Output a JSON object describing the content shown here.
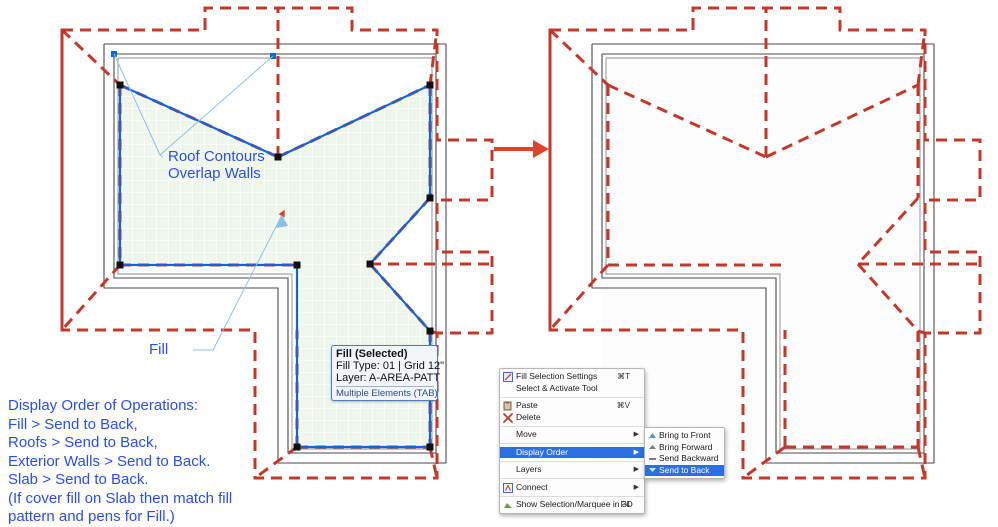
{
  "annotations": {
    "roof_contours": "Roof Contours\nOverlap Walls",
    "fill": "Fill",
    "notes": "Display Order of Operations:\nFill > Send to Back,\nRoofs > Send to Back,\nExterior Walls > Send to Back.\nSlab > Send to Back.\n(If cover fill on Slab then match fill\npattern and pens for Fill.)"
  },
  "info_box": {
    "title": "Fill (Selected)",
    "fill_type": "Fill Type: 01 | Grid 12\"",
    "layer": "Layer: A-AREA-PATT",
    "hint": "Multiple Elements (TAB)"
  },
  "context_menu": {
    "items": [
      {
        "label": "Fill Selection Settings",
        "shortcut": "⌘T",
        "icon": "fill-settings-icon",
        "submenu": false,
        "selected": false
      },
      {
        "label": "Select & Activate Tool",
        "shortcut": "",
        "icon": "",
        "submenu": false,
        "selected": false
      },
      {
        "label": "Paste",
        "shortcut": "⌘V",
        "icon": "paste-icon",
        "submenu": false,
        "selected": false
      },
      {
        "label": "Delete",
        "shortcut": "",
        "icon": "delete-icon",
        "submenu": false,
        "selected": false
      },
      {
        "label": "Move",
        "shortcut": "",
        "icon": "",
        "submenu": true,
        "selected": false
      },
      {
        "label": "Display Order",
        "shortcut": "",
        "icon": "",
        "submenu": true,
        "selected": true
      },
      {
        "label": "Layers",
        "shortcut": "",
        "icon": "",
        "submenu": true,
        "selected": false
      },
      {
        "label": "Connect",
        "shortcut": "",
        "icon": "connect-icon",
        "submenu": true,
        "selected": false
      },
      {
        "label": "Show Selection/Marquee in 3D",
        "shortcut": "F4",
        "icon": "show-3d-icon",
        "submenu": false,
        "selected": false
      }
    ]
  },
  "submenu": {
    "items": [
      {
        "label": "Bring to Front",
        "icon": "bring-to-front-icon",
        "selected": false
      },
      {
        "label": "Bring Forward",
        "icon": "bring-forward-icon",
        "selected": false
      },
      {
        "label": "Send Backward",
        "icon": "send-backward-icon",
        "selected": false
      },
      {
        "label": "Send to Back",
        "icon": "send-to-back-icon",
        "selected": true
      }
    ]
  },
  "colors": {
    "roof_contour_red": "#c0392b",
    "selection_blue": "#1565d8",
    "annotation_blue": "#2b4fe0",
    "fill_green": "#eff6ec",
    "wall_gray": "#555555",
    "menu_highlight": "#2b6fe0",
    "leader_line_blue": "#8cc0e8"
  },
  "plans": {
    "left": {
      "label": "selected-plan",
      "has_fill": true,
      "has_selection": true
    },
    "right": {
      "label": "result-plan",
      "has_fill": false,
      "has_selection": false
    }
  },
  "transition_arrow": {
    "direction": "right"
  }
}
